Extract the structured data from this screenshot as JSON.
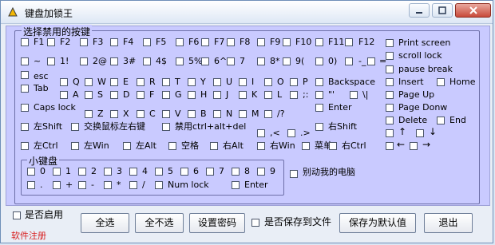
{
  "window": {
    "title": "键盘加锁王"
  },
  "groups": {
    "main": "选择禁用的按键",
    "numpad": "小键盘"
  },
  "keys": {
    "row1": [
      "F1",
      "F2",
      "F3",
      "F4",
      "F5",
      "F6",
      "F7",
      "F8",
      "F9",
      "F10",
      "F11",
      "F12"
    ],
    "row2": [
      "~",
      "1!",
      "2@",
      "3#",
      "4$",
      "5%",
      "6^",
      "7",
      "8*",
      "9(",
      "0)",
      "-_",
      "="
    ],
    "row3": [
      "esc",
      "Q",
      "W",
      "E",
      "R",
      "T",
      "Y",
      "U",
      "I",
      "O",
      "P",
      "Backspace"
    ],
    "row4": [
      "Tab",
      "A",
      "S",
      "D",
      "F",
      "G",
      "H",
      "J",
      "K",
      "L",
      ";:",
      "\"'",
      "\\|"
    ],
    "row5": [
      "Caps lock",
      "Enter"
    ],
    "row6": [
      "Z",
      "X",
      "C",
      "V",
      "B",
      "N",
      "M",
      "/?"
    ],
    "row7": [
      "左Shift",
      "交换鼠标左右键",
      "禁用ctrl+alt+del",
      ",<",
      ".>",
      "右Shift"
    ],
    "row8": [
      "左Ctrl",
      "左Win",
      "左Alt",
      "空格",
      "右Alt",
      "右Win",
      "菜单",
      "右Ctrl"
    ],
    "right": [
      "Print screen",
      "scroll lock",
      "pause break",
      "Insert",
      "Home",
      "Page Up",
      "Page Donw",
      "Delete",
      "End"
    ],
    "numpad_row1": [
      "0",
      "1",
      "2",
      "3",
      "4",
      "5",
      "6",
      "7",
      "8",
      "9"
    ],
    "numpad_row2": [
      ".",
      "+",
      "-",
      "*",
      "/",
      "Num lock",
      "Enter"
    ],
    "extra": "别动我的电脑"
  },
  "bottom": {
    "enable_label": "是否启用",
    "buttons": [
      "全选",
      "全不选",
      "设置密码",
      "是否保存到文件",
      "保存为默认值",
      "退出"
    ],
    "link": "软件注册"
  }
}
